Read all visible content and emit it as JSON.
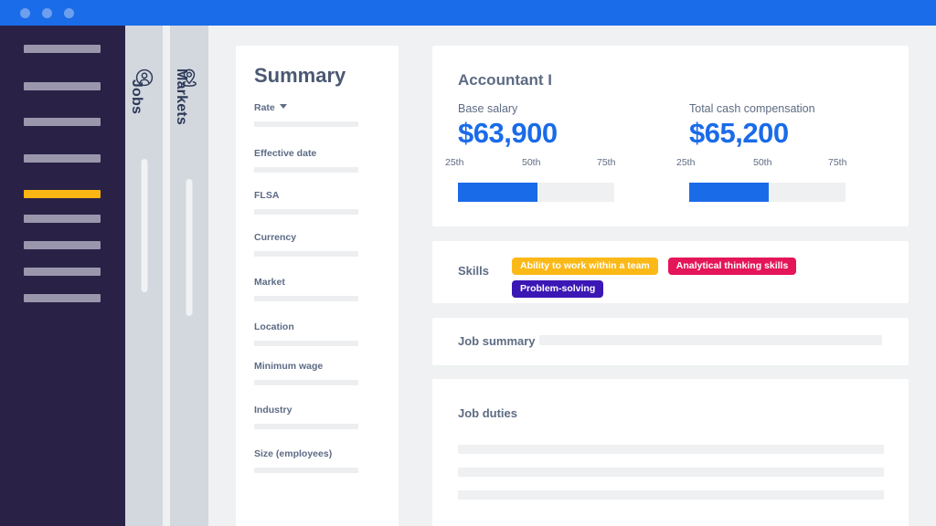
{
  "titlebar": {
    "dots": 3
  },
  "sidebar": {
    "items": [
      {
        "label": "",
        "active": false
      },
      {
        "label": "",
        "active": false
      },
      {
        "label": "",
        "active": false
      },
      {
        "label": "",
        "active": false
      },
      {
        "label": "",
        "active": true
      },
      {
        "label": "",
        "active": false
      },
      {
        "label": "",
        "active": false
      },
      {
        "label": "",
        "active": false
      },
      {
        "label": "",
        "active": false
      }
    ],
    "active_color": "#fbb614",
    "item_color": "#9a97ad",
    "background": "#2a2147"
  },
  "tabs": [
    {
      "label": "Jobs",
      "icon": "user-circle-icon",
      "selected": false
    },
    {
      "label": "Markets",
      "icon": "map-pin-icon",
      "selected": false
    }
  ],
  "summary": {
    "title": "Summary",
    "fields": [
      {
        "label": "Rate",
        "value": "",
        "has_dropdown": true
      },
      {
        "label": "Effective date",
        "value": "",
        "has_dropdown": false
      },
      {
        "label": "FLSA",
        "value": "",
        "has_dropdown": false
      },
      {
        "label": "Currency",
        "value": "",
        "has_dropdown": false
      },
      {
        "label": "Market",
        "value": "",
        "has_dropdown": false
      },
      {
        "label": "Location",
        "value": "",
        "has_dropdown": false
      },
      {
        "label": "Minimum wage",
        "value": "",
        "has_dropdown": false
      },
      {
        "label": "Industry",
        "value": "",
        "has_dropdown": false
      },
      {
        "label": "Size (employees)",
        "value": "",
        "has_dropdown": false
      }
    ]
  },
  "salary": {
    "job_title": "Accountant I",
    "accent_color": "#1a6be8",
    "base": {
      "label": "Base salary",
      "value": "$63,900",
      "ticks": [
        "25th",
        "50th",
        "75th"
      ],
      "fill_percent": 51
    },
    "total": {
      "label": "Total cash compensation",
      "value": "$65,200",
      "ticks": [
        "25th",
        "50th",
        "75th"
      ],
      "fill_percent": 51
    }
  },
  "skills": {
    "label": "Skills",
    "tags": [
      {
        "text": "Ability to work within a team",
        "color": "#fbb918"
      },
      {
        "text": "Analytical thinking skills",
        "color": "#e41558"
      },
      {
        "text": "Problem-solving",
        "color": "#3b17b5"
      }
    ]
  },
  "job_summary": {
    "label": "Job summary",
    "value": ""
  },
  "job_duties": {
    "label": "Job duties",
    "lines": [
      "",
      "",
      ""
    ]
  }
}
